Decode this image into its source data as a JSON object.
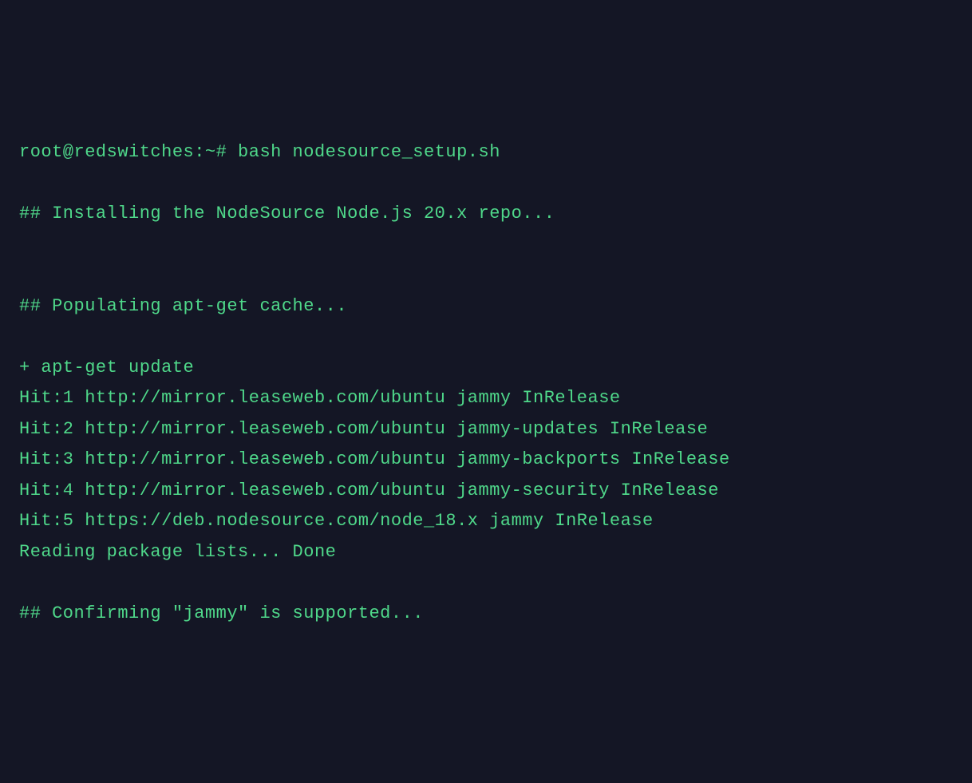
{
  "terminal": {
    "lines": [
      "root@redswitches:~# bash nodesource_setup.sh",
      "",
      "## Installing the NodeSource Node.js 20.x repo...",
      "",
      "",
      "## Populating apt-get cache...",
      "",
      "+ apt-get update",
      "Hit:1 http://mirror.leaseweb.com/ubuntu jammy InRelease",
      "Hit:2 http://mirror.leaseweb.com/ubuntu jammy-updates InRelease",
      "Hit:3 http://mirror.leaseweb.com/ubuntu jammy-backports InRelease",
      "Hit:4 http://mirror.leaseweb.com/ubuntu jammy-security InRelease",
      "Hit:5 https://deb.nodesource.com/node_18.x jammy InRelease",
      "Reading package lists... Done",
      "",
      "## Confirming \"jammy\" is supported..."
    ]
  }
}
